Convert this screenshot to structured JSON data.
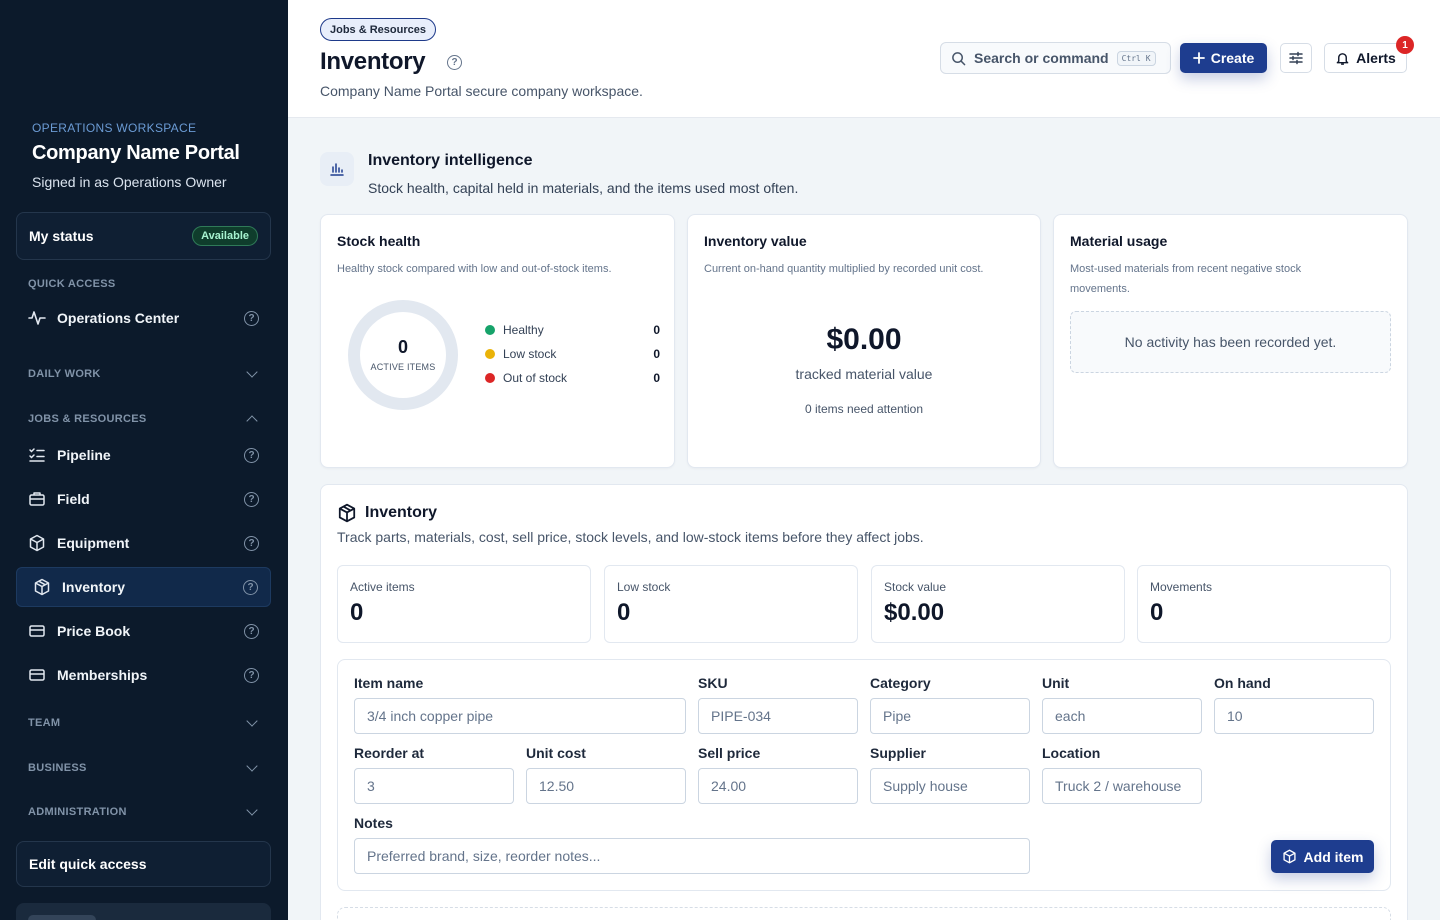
{
  "sidebar": {
    "workspace_label": "OPERATIONS WORKSPACE",
    "workspace_title": "Company Name Portal",
    "signed_in": "Signed in as Operations Owner",
    "status_label": "My status",
    "status_badge": "Available",
    "sections": {
      "quick_access": "QUICK ACCESS",
      "daily_work": "DAILY WORK",
      "jobs_resources": "JOBS & RESOURCES",
      "team": "TEAM",
      "business": "BUSINESS",
      "administration": "ADMINISTRATION"
    },
    "items": [
      {
        "label": "Operations Center",
        "icon": "activity-icon"
      },
      {
        "label": "Pipeline",
        "icon": "list-checks-icon"
      },
      {
        "label": "Field",
        "icon": "briefcase-icon"
      },
      {
        "label": "Equipment",
        "icon": "box-icon"
      },
      {
        "label": "Inventory",
        "icon": "package-icon",
        "active": true
      },
      {
        "label": "Price Book",
        "icon": "book-card-icon"
      },
      {
        "label": "Memberships",
        "icon": "card-icon"
      }
    ],
    "edit_quick_access": "Edit quick access"
  },
  "header": {
    "breadcrumb": "Jobs & Resources",
    "title": "Inventory",
    "subtitle": "Company Name Portal secure company workspace.",
    "search_label": "Search or command",
    "search_shortcut": "Ctrl K",
    "create_label": "Create",
    "alerts_label": "Alerts",
    "alerts_count": "1"
  },
  "intelligence": {
    "title": "Inventory intelligence",
    "subtitle": "Stock health, capital held in materials, and the items used most often.",
    "stock_health": {
      "title": "Stock health",
      "subtitle": "Healthy stock compared with low and out-of-stock items.",
      "active_count": "0",
      "active_label": "ACTIVE ITEMS",
      "legend": [
        {
          "name": "Healthy",
          "value": "0",
          "color": "#16a36a"
        },
        {
          "name": "Low stock",
          "value": "0",
          "color": "#eab308"
        },
        {
          "name": "Out of stock",
          "value": "0",
          "color": "#dc2626"
        }
      ]
    },
    "inventory_value": {
      "title": "Inventory value",
      "subtitle": "Current on-hand quantity multiplied by recorded unit cost.",
      "value": "$0.00",
      "caption": "tracked material value",
      "attention": "0 items need attention"
    },
    "material_usage": {
      "title": "Material usage",
      "subtitle": "Most-used materials from recent negative stock movements.",
      "empty": "No activity has been recorded yet."
    }
  },
  "inventory": {
    "title": "Inventory",
    "subtitle": "Track parts, materials, cost, sell price, stock levels, and low-stock items before they affect jobs.",
    "stats": [
      {
        "label": "Active items",
        "value": "0"
      },
      {
        "label": "Low stock",
        "value": "0"
      },
      {
        "label": "Stock value",
        "value": "$0.00"
      },
      {
        "label": "Movements",
        "value": "0"
      }
    ],
    "form": {
      "item_name": {
        "label": "Item name",
        "placeholder": "3/4 inch copper pipe"
      },
      "sku": {
        "label": "SKU",
        "placeholder": "PIPE-034"
      },
      "category": {
        "label": "Category",
        "placeholder": "Pipe"
      },
      "unit": {
        "label": "Unit",
        "placeholder": "each"
      },
      "on_hand": {
        "label": "On hand",
        "placeholder": "10"
      },
      "reorder_at": {
        "label": "Reorder at",
        "placeholder": "3"
      },
      "unit_cost": {
        "label": "Unit cost",
        "placeholder": "12.50"
      },
      "sell_price": {
        "label": "Sell price",
        "placeholder": "24.00"
      },
      "supplier": {
        "label": "Supplier",
        "placeholder": "Supply house"
      },
      "location": {
        "label": "Location",
        "placeholder": "Truck 2 / warehouse"
      },
      "notes": {
        "label": "Notes",
        "placeholder": "Preferred brand, size, reorder notes..."
      },
      "add_label": "Add item"
    }
  },
  "colors": {
    "sidebar_bg": "#0c1a2b",
    "accent": "#1e3d8f",
    "alert": "#dc2626"
  }
}
